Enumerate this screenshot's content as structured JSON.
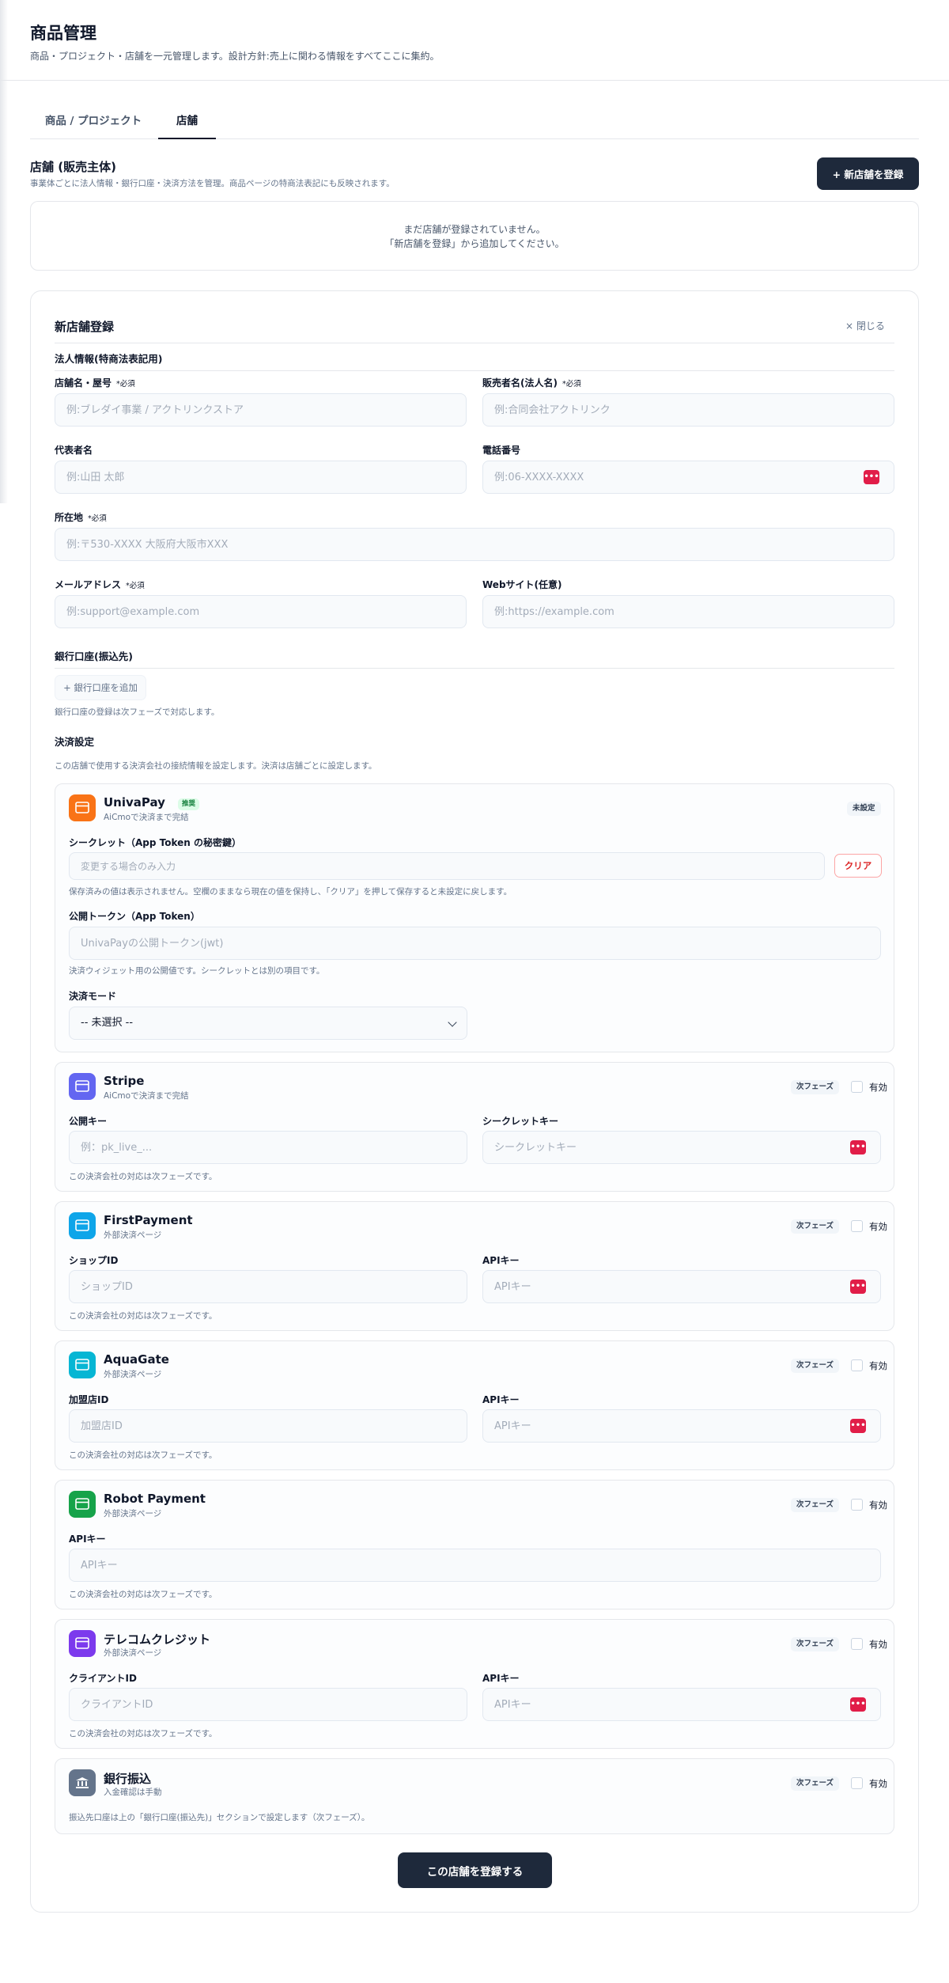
{
  "page": {
    "title": "商品管理",
    "subtitle": "商品・プロジェクト・店舗を一元管理します。設計方針:売上に関わる情報をすべてここに集約。"
  },
  "tabs": [
    {
      "label": "商品 / プロジェクト"
    },
    {
      "label": "店舗"
    }
  ],
  "section": {
    "title": "店舗 (販売主体)",
    "desc": "事業体ごとに法人情報・銀行口座・決済方法を管理。商品ページの特商法表記にも反映されます。",
    "new_button": "+ 新店舗を登録",
    "empty_line1": "まだ店舗が登録されていません。",
    "empty_line2": "「新店舗を登録」から追加してください。"
  },
  "form": {
    "title": "新店舗登録",
    "close": "× 閉じる",
    "corp_group": "法人情報(特商法表記用)",
    "required": "*必須",
    "fields": {
      "store_name": {
        "label": "店舗名・屋号",
        "placeholder": "例:ブレダイ事業 / アクトリンクストア"
      },
      "seller": {
        "label": "販売者名(法人名)",
        "placeholder": "例:合同会社アクトリンク"
      },
      "rep": {
        "label": "代表者名",
        "placeholder": "例:山田 太郎"
      },
      "phone": {
        "label": "電話番号",
        "placeholder": "例:06-XXXX-XXXX"
      },
      "address": {
        "label": "所在地",
        "placeholder": "例:〒530-XXXX 大阪府大阪市XXX"
      },
      "email": {
        "label": "メールアドレス",
        "placeholder": "例:support@example.com"
      },
      "web": {
        "label": "Webサイト(任意)",
        "placeholder": "例:https://example.com"
      }
    },
    "bank_group": "銀行口座(振込先)",
    "bank_add": "+ 銀行口座を追加",
    "bank_note": "銀行口座の登録は次フェーズで対応します。",
    "pay_group": "決済設定",
    "pay_desc": "この店舗で使用する決済会社の接続情報を設定します。決済は店舗ごとに設定します。",
    "submit": "この店舗を登録する"
  },
  "payments": {
    "univapay": {
      "name": "UnivaPay",
      "badge": "推奨",
      "sub": "AiCmoで決済まで完結",
      "status": "未設定",
      "secret_label": "シークレット（App Token の秘密鍵）",
      "secret_placeholder": "変更する場合のみ入力",
      "clear": "クリア",
      "secret_note": "保存済みの値は表示されません。空欄のままなら現在の値を保持し、「クリア」を押して保存すると未設定に戻します。",
      "token_label": "公開トークン（App Token）",
      "token_placeholder": "UnivaPayの公開トークン(jwt)",
      "token_note": "決済ウィジェット用の公開値です。シークレットとは別の項目です。",
      "mode_label": "決済モード",
      "mode_value": "-- 未選択 --"
    },
    "phase": "次フェーズ",
    "enable": "有効",
    "phase_note": "この決済会社の対応は次フェーズです。",
    "stripe": {
      "name": "Stripe",
      "sub": "AiCmoで決済まで完結",
      "f1": "公開キー",
      "p1": "例：pk_live_...",
      "f2": "シークレットキー",
      "p2": "シークレットキー"
    },
    "firstpayment": {
      "name": "FirstPayment",
      "sub": "外部決済ページ",
      "f1": "ショップID",
      "p1": "ショップID",
      "f2": "APIキー",
      "p2": "APIキー"
    },
    "aquagate": {
      "name": "AquaGate",
      "sub": "外部決済ページ",
      "f1": "加盟店ID",
      "p1": "加盟店ID",
      "f2": "APIキー",
      "p2": "APIキー"
    },
    "robot": {
      "name": "Robot Payment",
      "sub": "外部決済ページ",
      "f1": "APIキー",
      "p1": "APIキー"
    },
    "telecom": {
      "name": "テレコムクレジット",
      "sub": "外部決済ページ",
      "f1": "クライアントID",
      "p1": "クライアントID",
      "f2": "APIキー",
      "p2": "APIキー"
    },
    "bank": {
      "name": "銀行振込",
      "sub": "入金確認は手動",
      "note": "振込先口座は上の「銀行口座(振込先)」セクションで設定します（次フェーズ）。"
    }
  },
  "colors": {
    "univapay": "#f97316",
    "stripe": "#6366f1",
    "firstpayment": "#0ea5e9",
    "aquagate": "#06b6d4",
    "robot": "#16a34a",
    "telecom": "#7c3aed",
    "bank": "#64748b",
    "primary": "#1e293b"
  },
  "icons": {
    "provider": "credit-card-icon",
    "bank": "bank-building-icon",
    "password": "password-dots-icon",
    "select": "chevron-down-icon"
  }
}
